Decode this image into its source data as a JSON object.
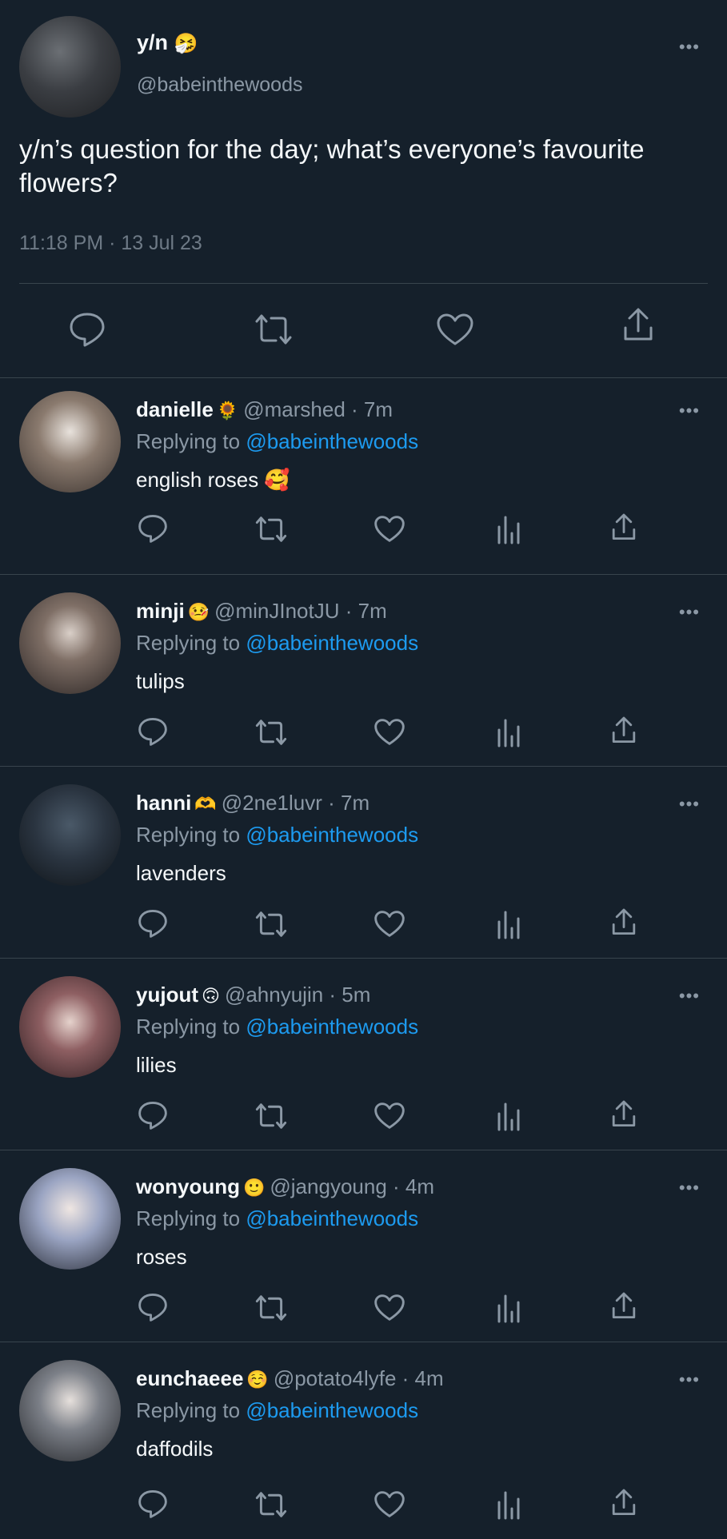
{
  "main_tweet": {
    "author_name": "y/n",
    "author_emoji": "🤧",
    "handle": "@babeinthewoods",
    "text": "y/n’s question for the day; what’s everyone’s favourite flowers?",
    "timestamp": "11:18 PM · 13 Jul 23",
    "more_label": "•••"
  },
  "replies": [
    {
      "name": "danielle",
      "emoji": "🌻",
      "handle": "@marshed",
      "time": "· 7m",
      "replying_prefix": "Replying to",
      "replying_to": "@babeinthewoods",
      "text": "english roses 🥰"
    },
    {
      "name": "minji",
      "emoji": "🤒",
      "handle": "@minJInotJU",
      "time": "· 7m",
      "replying_prefix": "Replying to",
      "replying_to": "@babeinthewoods",
      "text": "tulips"
    },
    {
      "name": "hanni",
      "emoji": "🫶",
      "handle": "@2ne1luvr",
      "time": "· 7m",
      "replying_prefix": "Replying to",
      "replying_to": "@babeinthewoods",
      "text": "lavenders"
    },
    {
      "name": "yujout",
      "emoji": "🙃",
      "handle": "@ahnyujin",
      "time": "· 5m",
      "replying_prefix": "Replying to",
      "replying_to": "@babeinthewoods",
      "text": "lilies"
    },
    {
      "name": "wonyoung",
      "emoji": "🙂",
      "handle": "@jangyoung",
      "time": "· 4m",
      "replying_prefix": "Replying to",
      "replying_to": "@babeinthewoods",
      "text": "roses"
    },
    {
      "name": "eunchaeee",
      "emoji": "☺️",
      "handle": "@potato4lyfe",
      "time": "· 4m",
      "replying_prefix": "Replying to",
      "replying_to": "@babeinthewoods",
      "text": "daffodils"
    }
  ],
  "colors": {
    "background": "#15202b",
    "text": "#f5f8fa",
    "secondary_text": "#8b98a5",
    "link": "#1d9bf0",
    "divider": "#38444d"
  }
}
